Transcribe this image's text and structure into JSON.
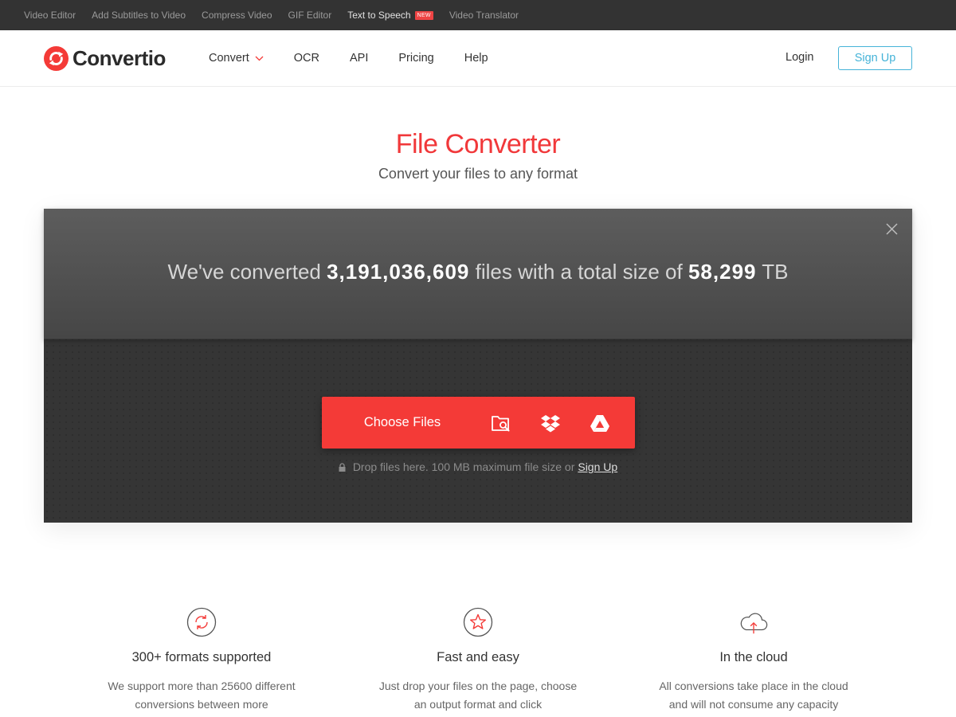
{
  "topbar": {
    "links": [
      {
        "label": "Video Editor"
      },
      {
        "label": "Add Subtitles to Video"
      },
      {
        "label": "Compress Video"
      },
      {
        "label": "GIF Editor"
      },
      {
        "label": "Text to Speech",
        "badge": "NEW"
      },
      {
        "label": "Video Translator"
      }
    ]
  },
  "header": {
    "logo_text": "Convertio",
    "nav": [
      {
        "label": "Convert",
        "icon": "chevron-down-icon"
      },
      {
        "label": "OCR"
      },
      {
        "label": "API"
      },
      {
        "label": "Pricing"
      },
      {
        "label": "Help"
      }
    ],
    "login_label": "Login",
    "signup_label": "Sign Up"
  },
  "hero": {
    "title": "File Converter",
    "subtitle": "Convert your files to any format"
  },
  "stats": {
    "prefix": "We've converted",
    "files_count": "3,191,036,609",
    "middle": "files with a total size of",
    "total_size": "58,299",
    "unit": "TB"
  },
  "upload": {
    "choose_label": "Choose Files",
    "sources": [
      "folder-search-icon",
      "dropbox-icon",
      "google-drive-icon"
    ],
    "hint_text": "Drop files here. 100 MB maximum file size or",
    "hint_link": "Sign Up"
  },
  "features": [
    {
      "icon": "refresh-icon",
      "title": "300+ formats supported",
      "text": "We support more than 25600 different conversions between more"
    },
    {
      "icon": "star-icon",
      "title": "Fast and easy",
      "text": "Just drop your files on the page, choose an output format and click"
    },
    {
      "icon": "cloud-upload-icon",
      "title": "In the cloud",
      "text": "All conversions take place in the cloud and will not consume any capacity"
    }
  ],
  "colors": {
    "brand_red": "#f43a37",
    "title_red": "#f1383a",
    "accent_blue": "#45b3d8",
    "topbar_bg": "#333333",
    "converter_bg": "#353535"
  }
}
